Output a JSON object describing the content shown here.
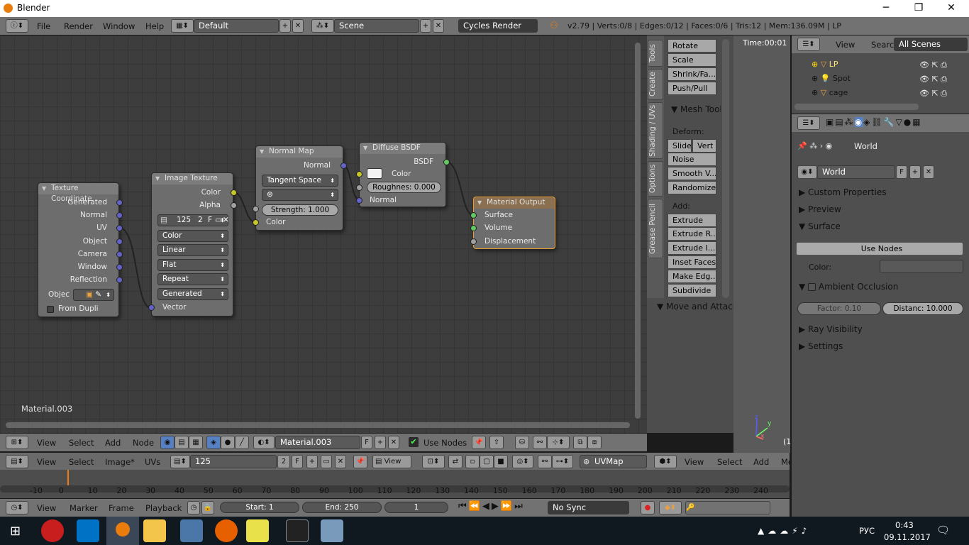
{
  "window": {
    "title": "Blender",
    "min": "─",
    "max": "❐",
    "close": "✕"
  },
  "infobar": {
    "menus": [
      "File",
      "Render",
      "Window",
      "Help"
    ],
    "layout": "Default",
    "scene": "Scene",
    "engine": "Cycles Render",
    "stats": "v2.79 | Verts:0/8 | Edges:0/12 | Faces:0/6 | Tris:12 | Mem:136.09M | LP"
  },
  "nodes": {
    "texcoord": {
      "title": "Texture Coordinate",
      "outputs": [
        "Generated",
        "Normal",
        "UV",
        "Object",
        "Camera",
        "Window",
        "Reflection"
      ],
      "objlabel": "Objec",
      "from_dupli": "From Dupli"
    },
    "imgtex": {
      "title": "Image Texture",
      "outputs": [
        "Color",
        "Alpha"
      ],
      "image_name": "125",
      "users": "2",
      "fake": "F",
      "options": [
        "Color",
        "Linear",
        "Flat",
        "Repeat",
        "Generated"
      ],
      "input": "Vector"
    },
    "normalmap": {
      "title": "Normal Map",
      "output": "Normal",
      "space": "Tangent Space",
      "strength": "Strength:",
      "strength_value": "1.000",
      "input": "Color"
    },
    "diffuse": {
      "title": "Diffuse BSDF",
      "output": "BSDF",
      "color": "Color",
      "roughness": "Roughnes: 0.000",
      "normal": "Normal"
    },
    "matout": {
      "title": "Material Output",
      "inputs": [
        "Surface",
        "Volume",
        "Displacement"
      ]
    }
  },
  "node_editor": {
    "material_label": "Material.003",
    "header": {
      "menus": [
        "View",
        "Select",
        "Add",
        "Node"
      ],
      "material": "Material.003",
      "fake": "F",
      "use_nodes": "Use Nodes"
    }
  },
  "image_editor_header": {
    "menus": [
      "View",
      "Select",
      "Image*",
      "UVs"
    ],
    "image": "125",
    "users": "2",
    "fake": "F",
    "view": "View",
    "uvmap": "UVMap"
  },
  "toolshelf": {
    "tabs": [
      "Tools",
      "Create",
      "Shading / UVs",
      "Options",
      "Grease Pencil"
    ],
    "buttons_top": [
      "Rotate",
      "Scale",
      "Shrink/Fa...",
      "Push/Pull"
    ],
    "mesh_tools": "Mesh Tool",
    "deform": "Deform:",
    "slide": "Slide",
    "vert": "Vert",
    "deform_buttons": [
      "Noise",
      "Smooth V...",
      "Randomize"
    ],
    "add": "Add:",
    "add_buttons": [
      "Extrude",
      "Extrude R...",
      "Extrude I...",
      "Inset Faces",
      "Make Edg...",
      "Subdivide"
    ],
    "move_attach": "Move and Attach"
  },
  "viewport": {
    "time": "Time:00:01",
    "menus": [
      "View",
      "Select",
      "Add",
      "Me"
    ],
    "axis_z": "z",
    "axis_y": "y",
    "axis_x": "x",
    "frame_hint": "(1"
  },
  "outliner": {
    "menus": [
      "View",
      "Search"
    ],
    "filter": "All Scenes",
    "items": [
      "LP",
      "Spot",
      "cage"
    ]
  },
  "properties": {
    "context": "World",
    "world_name": "World",
    "fake": "F",
    "panels": {
      "custom": "Custom Properties",
      "preview": "Preview",
      "surface": "Surface",
      "use_nodes": "Use Nodes",
      "color": "Color:",
      "ao": "Ambient Occlusion",
      "factor": "Factor:",
      "factor_value": "0.10",
      "distance": "Distanc: 10.000",
      "ray": "Ray Visibility",
      "settings": "Settings"
    }
  },
  "timeline": {
    "ticks": [
      "-10",
      "0",
      "10",
      "20",
      "30",
      "40",
      "50",
      "60",
      "70",
      "80",
      "90",
      "100",
      "110",
      "120",
      "130",
      "140",
      "150",
      "160",
      "170",
      "180",
      "190",
      "200",
      "210",
      "220",
      "230",
      "240"
    ],
    "menus": [
      "View",
      "Marker",
      "Frame",
      "Playback"
    ],
    "start": "Start:",
    "start_value": "1",
    "end": "End:",
    "end_value": "250",
    "current": "1",
    "sync": "No Sync"
  },
  "taskbar": {
    "lang": "РУС",
    "time": "0:43",
    "date": "09.11.2017"
  },
  "colors": {
    "header": "#727272",
    "node_bg": "#3d3d3d",
    "accent": "#e87d0d"
  }
}
